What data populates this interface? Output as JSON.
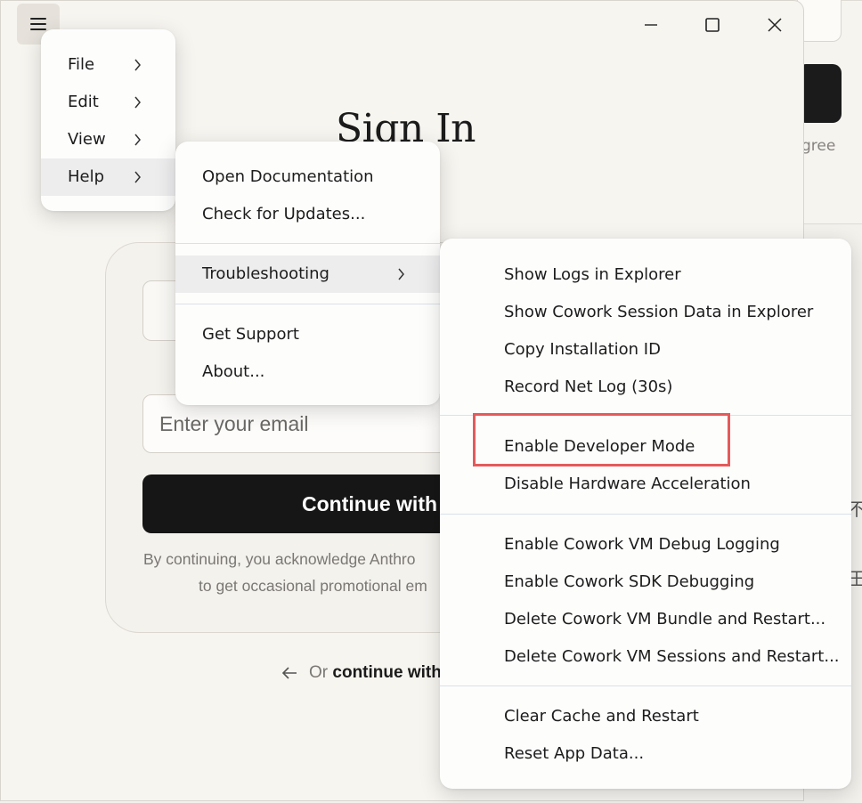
{
  "window": {
    "title": "Sign In"
  },
  "background": {
    "agree_fragment": "gree",
    "cjk_fragment_1": "不",
    "cjk_fragment_2": "王"
  },
  "login": {
    "email_placeholder": "Enter your email",
    "continue_label": "Continue with",
    "disclaimer_line1": "By continuing, you acknowledge Anthro",
    "disclaimer_line2": "to get occasional promotional em",
    "alt_prefix": "Or",
    "alt_link": "continue with"
  },
  "menus": {
    "main": {
      "items": [
        {
          "label": "File"
        },
        {
          "label": "Edit"
        },
        {
          "label": "View"
        },
        {
          "label": "Help",
          "active": true
        }
      ]
    },
    "help": {
      "items": [
        {
          "label": "Open Documentation"
        },
        {
          "label": "Check for Updates..."
        },
        {
          "label": "Troubleshooting",
          "active": true
        },
        {
          "label": "Get Support"
        },
        {
          "label": "About..."
        }
      ]
    },
    "troubleshooting": {
      "items": [
        {
          "label": "Show Logs in Explorer"
        },
        {
          "label": "Show Cowork Session Data in Explorer"
        },
        {
          "label": "Copy Installation ID"
        },
        {
          "label": "Record Net Log (30s)"
        },
        {
          "label": "Enable Developer Mode",
          "highlighted": true
        },
        {
          "label": "Disable Hardware Acceleration"
        },
        {
          "label": "Enable Cowork VM Debug Logging"
        },
        {
          "label": "Enable Cowork SDK Debugging"
        },
        {
          "label": "Delete Cowork VM Bundle and Restart..."
        },
        {
          "label": "Delete Cowork VM Sessions and Restart..."
        },
        {
          "label": "Clear Cache and Restart"
        },
        {
          "label": "Reset App Data..."
        }
      ]
    }
  },
  "colors": {
    "highlight_border": "#e55a5a",
    "primary_button": "#161616",
    "window_bg": "#f7f5f0"
  }
}
